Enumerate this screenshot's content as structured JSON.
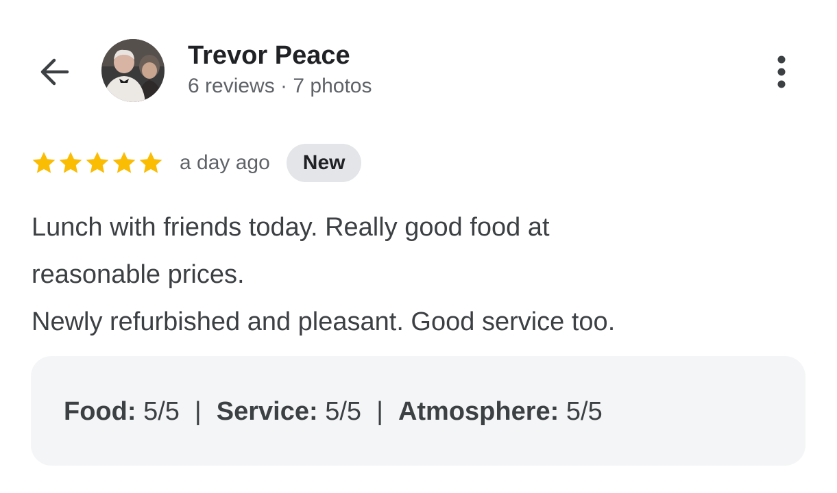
{
  "header": {
    "back_icon": "arrow-left-icon",
    "user_name": "Trevor Peace",
    "user_meta": "6 reviews · 7 photos",
    "more_icon": "more-vertical-icon"
  },
  "review": {
    "rating": 5,
    "rating_max": 5,
    "star_color": "#fbbc04",
    "time_ago": "a day ago",
    "badge": "New",
    "text_lines": [
      "Lunch with friends today. Really good food at",
      "reasonable prices.",
      "Newly refurbished and pleasant. Good service too."
    ]
  },
  "ratings": [
    {
      "label": "Food:",
      "value": "5/5"
    },
    {
      "label": "Service:",
      "value": "5/5"
    },
    {
      "label": "Atmosphere:",
      "value": "5/5"
    }
  ],
  "separator": "|"
}
